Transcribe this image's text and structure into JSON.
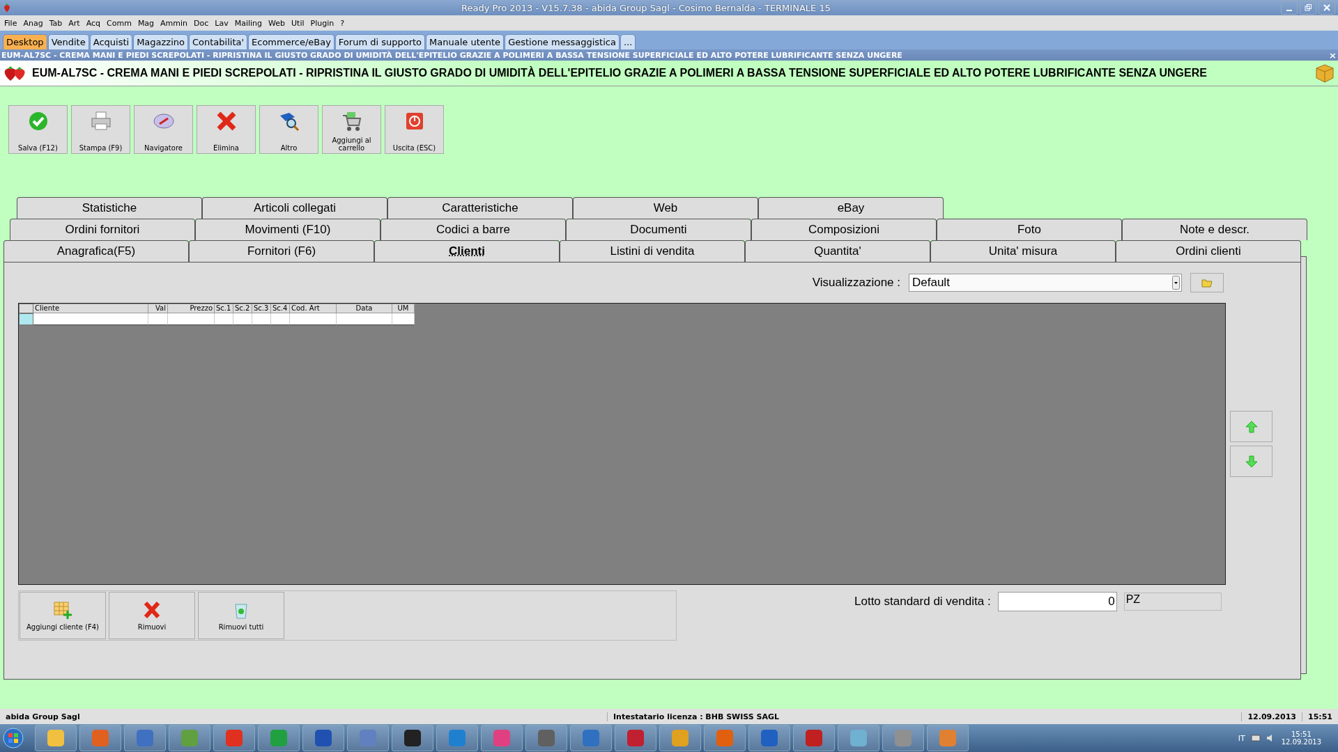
{
  "window": {
    "title": "Ready Pro 2013 - V15.7.38 - abida Group Sagl - Cosimo Bernalda - TERMINALE 15"
  },
  "menu": [
    "File",
    "Anag",
    "Tab",
    "Art",
    "Acq",
    "Comm",
    "Mag",
    "Ammin",
    "Doc",
    "Lav",
    "Mailing",
    "Web",
    "Util",
    "Plugin",
    "?"
  ],
  "module_tabs": [
    {
      "label": "Desktop",
      "selected": true
    },
    {
      "label": "Vendite",
      "selected": false
    },
    {
      "label": "Acquisti",
      "selected": false
    },
    {
      "label": "Magazzino",
      "selected": false
    },
    {
      "label": "Contabilita'",
      "selected": false
    },
    {
      "label": "Ecommerce/eBay",
      "selected": false
    },
    {
      "label": "Forum di supporto",
      "selected": false
    },
    {
      "label": "Manuale utente",
      "selected": false
    },
    {
      "label": "Gestione messaggistica",
      "selected": false
    },
    {
      "label": "...",
      "selected": false
    }
  ],
  "document_bar": {
    "title": "EUM-AL7SC - CREMA MANI E PIEDI SCREPOLATI - RIPRISTINA IL GIUSTO GRADO DI UMIDITÀ DELL'EPITELIO GRAZIE A POLIMERI A BASSA TENSIONE SUPERFICIALE ED ALTO POTERE LUBRIFICANTE SENZA UNGERE",
    "close": "×"
  },
  "header": {
    "title": "EUM-AL7SC - CREMA MANI E PIEDI SCREPOLATI - RIPRISTINA IL GIUSTO GRADO DI UMIDITÀ DELL'EPITELIO GRAZIE A POLIMERI A BASSA TENSIONE SUPERFICIALE ED ALTO POTERE LUBRIFICANTE SENZA UNGERE"
  },
  "toolbar": [
    {
      "label": "Salva (F12)",
      "kind": "save"
    },
    {
      "label": "Stampa (F9)",
      "kind": "print"
    },
    {
      "label": "Navigatore",
      "kind": "navigator"
    },
    {
      "label": "Elimina",
      "kind": "delete"
    },
    {
      "label": "Altro",
      "kind": "other"
    },
    {
      "label": "Aggiungi al carrello",
      "kind": "cart"
    },
    {
      "label": "Uscita (ESC)",
      "kind": "exit"
    }
  ],
  "tab_rows": [
    [
      {
        "label": "Statistiche",
        "selected": false
      },
      {
        "label": "Articoli collegati",
        "selected": false
      },
      {
        "label": "Caratteristiche",
        "selected": false
      },
      {
        "label": "Web",
        "selected": false
      },
      {
        "label": "eBay",
        "selected": false
      }
    ],
    [
      {
        "label": "Ordini fornitori",
        "selected": false
      },
      {
        "label": "Movimenti (F10)",
        "selected": false
      },
      {
        "label": "Codici a barre",
        "selected": false
      },
      {
        "label": "Documenti",
        "selected": false
      },
      {
        "label": "Composizioni",
        "selected": false
      },
      {
        "label": "Foto",
        "selected": false
      },
      {
        "label": "Note e descr.",
        "selected": false
      }
    ],
    [
      {
        "label": "Anagrafica(F5)",
        "selected": false
      },
      {
        "label": "Fornitori (F6)",
        "selected": false
      },
      {
        "label": "Clienti",
        "selected": true
      },
      {
        "label": "Listini di vendita",
        "selected": false
      },
      {
        "label": "Quantita'",
        "selected": false
      },
      {
        "label": "Unita' misura",
        "selected": false
      },
      {
        "label": "Ordini clienti",
        "selected": false
      }
    ]
  ],
  "view_selector": {
    "label": "Visualizzazione :",
    "value": "Default"
  },
  "grid": {
    "columns": [
      "Cliente",
      "Val",
      "Prezzo",
      "Sc.1",
      "Sc.2",
      "Sc.3",
      "Sc.4",
      "Cod. Art",
      "Data",
      "UM"
    ]
  },
  "bottom_buttons": [
    {
      "label": "Aggiungi cliente (F4)",
      "kind": "add"
    },
    {
      "label": "Rimuovi",
      "kind": "remove"
    },
    {
      "label": "Rimuovi tutti",
      "kind": "clear"
    }
  ],
  "lot": {
    "label": "Lotto standard di vendita :",
    "value": "0",
    "unit": "PZ"
  },
  "status_bar": {
    "company": "abida Group Sagl",
    "license": "Intestatario licenza : BHB SWISS SAGL",
    "date": "12.09.2013",
    "time": "15:51"
  },
  "taskbar": {
    "language": "IT",
    "time": "15:51",
    "date": "12.09.2013"
  }
}
